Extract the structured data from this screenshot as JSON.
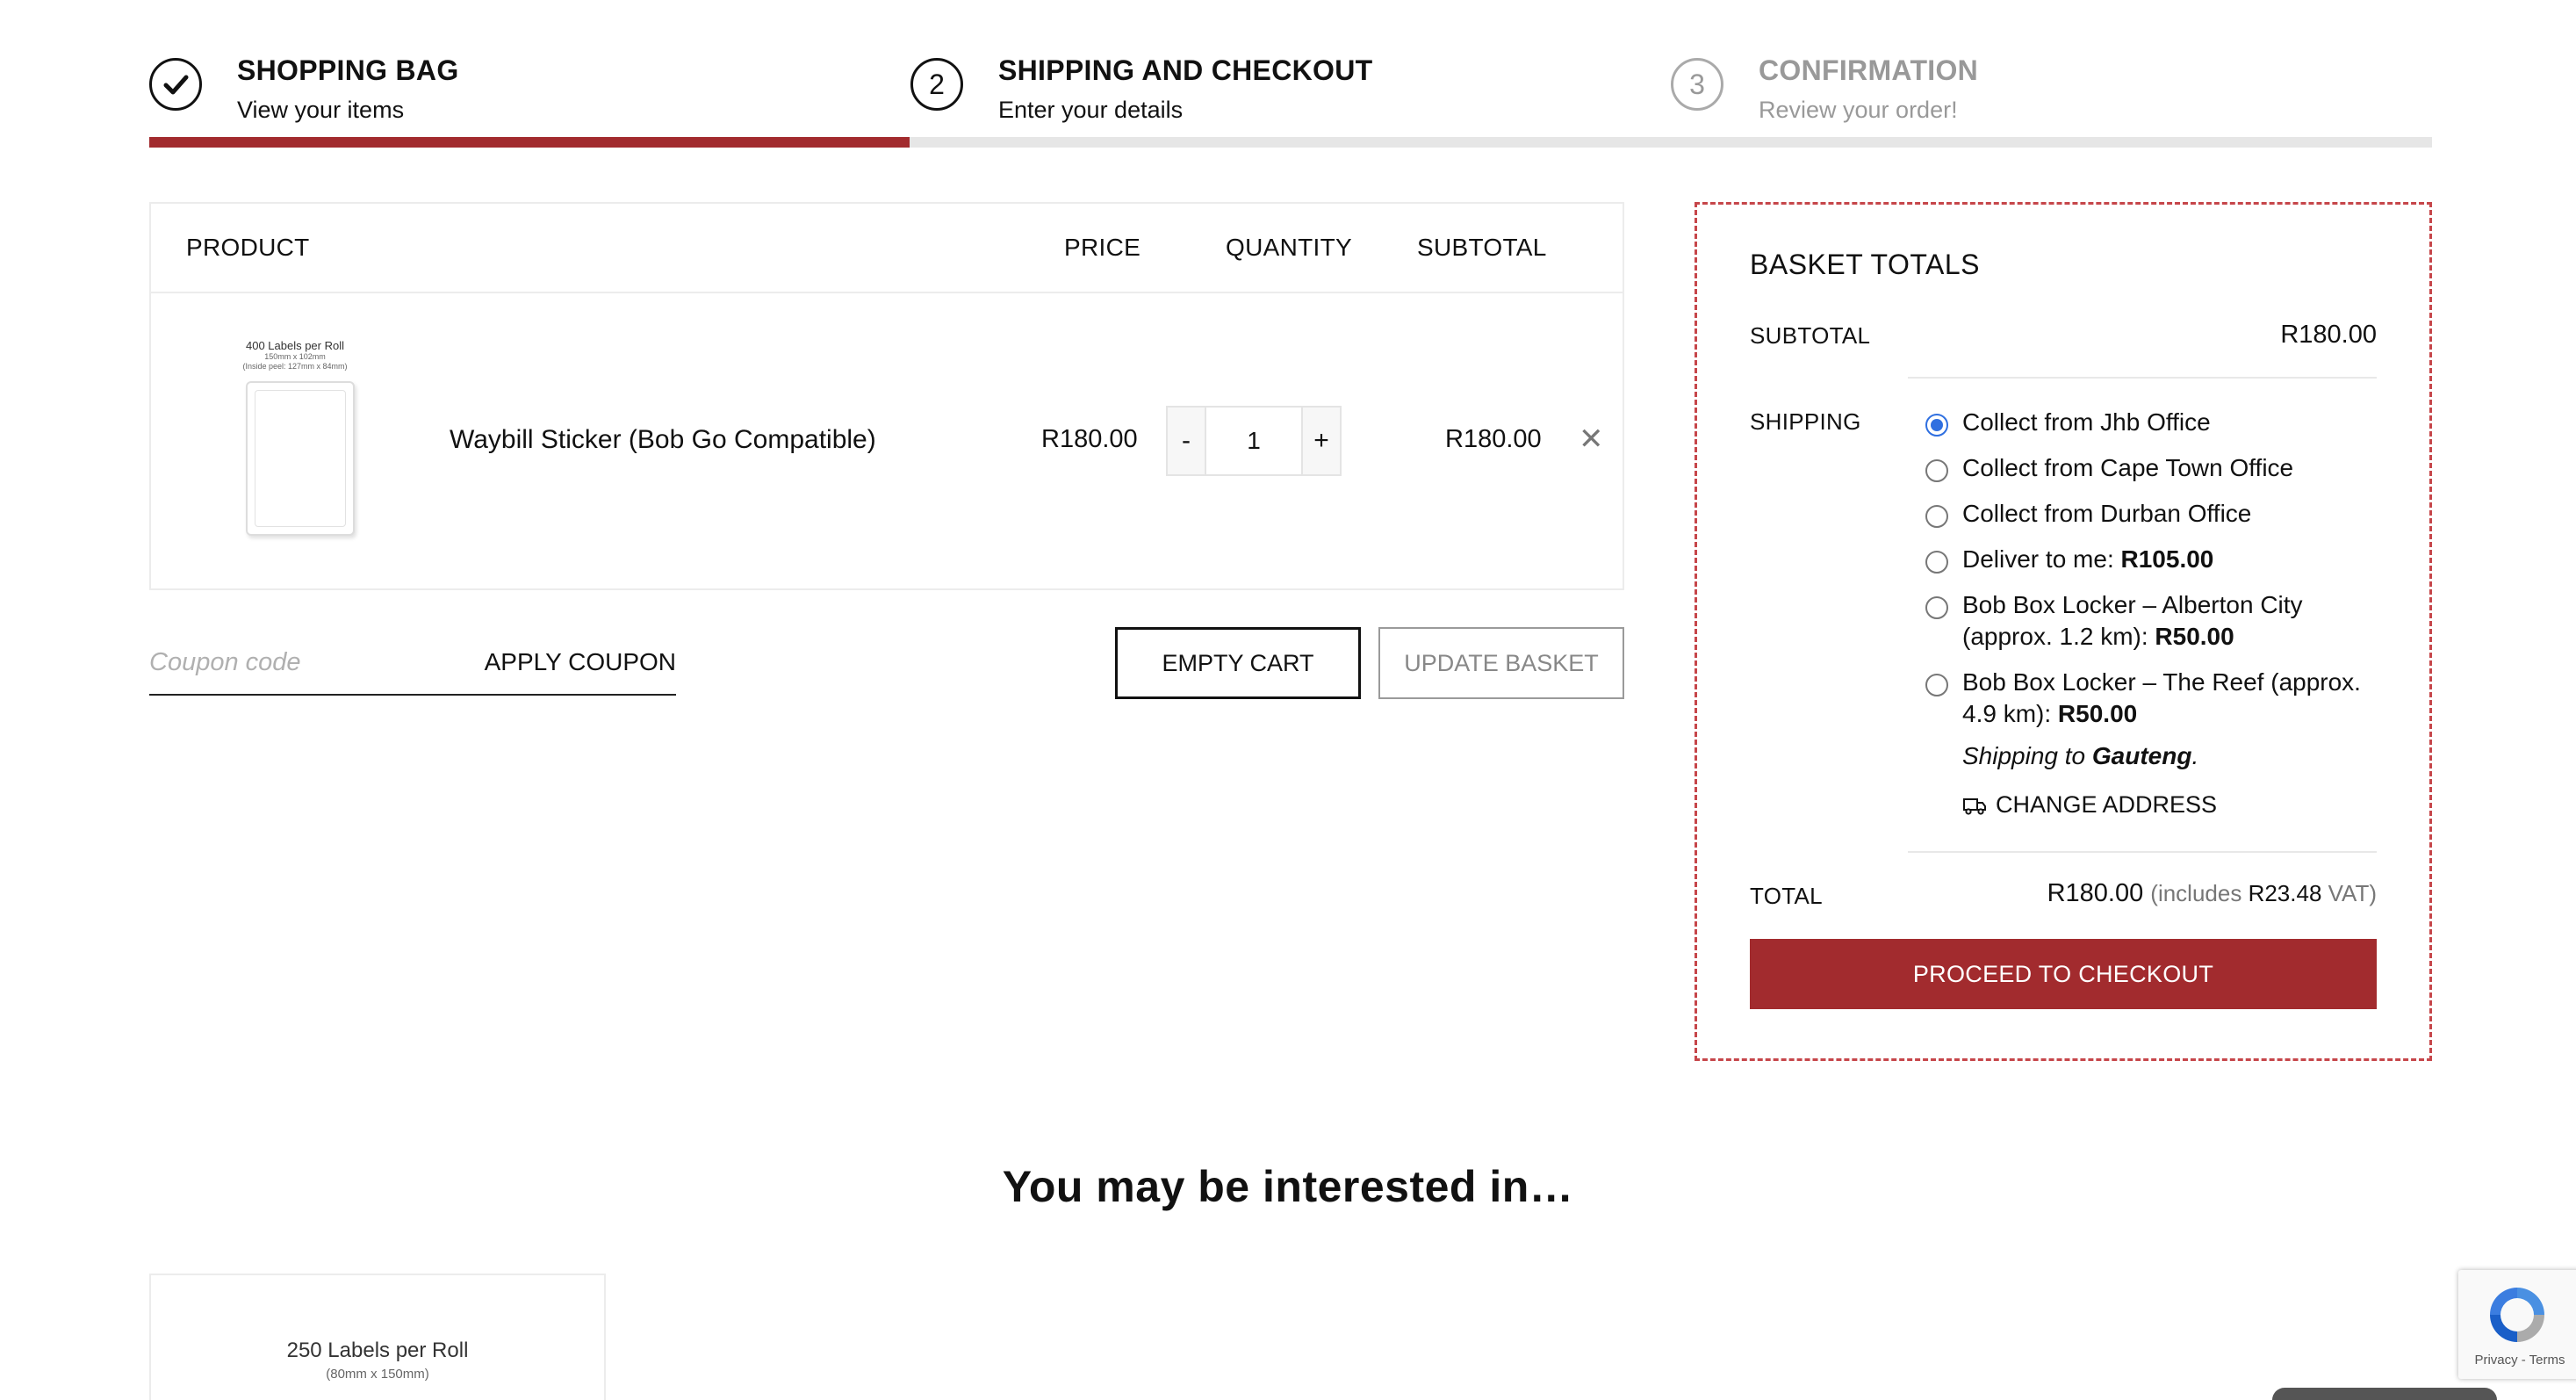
{
  "steps": [
    {
      "number": "1",
      "title": "SHOPPING BAG",
      "subtitle": "View your items",
      "state": "done"
    },
    {
      "number": "2",
      "title": "SHIPPING AND CHECKOUT",
      "subtitle": "Enter your details",
      "state": "current"
    },
    {
      "number": "3",
      "title": "CONFIRMATION",
      "subtitle": "Review your order!",
      "state": "upcoming"
    }
  ],
  "progress_fraction": 0.333,
  "cart": {
    "headers": {
      "product": "PRODUCT",
      "price": "PRICE",
      "quantity": "QUANTITY",
      "subtotal": "SUBTOTAL"
    },
    "items": [
      {
        "thumb_title": "400 Labels per Roll",
        "thumb_sub1": "150mm x 102mm",
        "thumb_sub2": "(Inside peel: 127mm x 84mm)",
        "name": "Waybill Sticker (Bob Go Compatible)",
        "price": "R180.00",
        "qty_minus": "-",
        "quantity": "1",
        "qty_plus": "+",
        "subtotal": "R180.00",
        "remove_icon": "close-x"
      }
    ]
  },
  "coupon": {
    "placeholder": "Coupon code",
    "apply_label": "APPLY COUPON"
  },
  "buttons": {
    "empty_cart": "EMPTY CART",
    "update_basket": "UPDATE BASKET"
  },
  "totals": {
    "title": "BASKET TOTALS",
    "subtotal_label": "SUBTOTAL",
    "subtotal_value": "R180.00",
    "shipping_label": "SHIPPING",
    "shipping_options": [
      {
        "text": "Collect from Jhb Office",
        "price": "",
        "checked": true
      },
      {
        "text": "Collect from Cape Town Office",
        "price": "",
        "checked": false
      },
      {
        "text": "Collect from Durban Office",
        "price": "",
        "checked": false
      },
      {
        "text": "Deliver to me: ",
        "price": "R105.00",
        "checked": false
      },
      {
        "text": "Bob Box Locker – Alberton City (approx. 1.2 km): ",
        "price": "R50.00",
        "checked": false
      },
      {
        "text": "Bob Box Locker – The Reef (approx. 4.9 km): ",
        "price": "R50.00",
        "checked": false
      }
    ],
    "shipping_to_prefix": "Shipping to ",
    "shipping_to_region": "Gauteng",
    "shipping_to_suffix": ".",
    "change_address": "CHANGE ADDRESS",
    "total_label": "TOTAL",
    "total_value": "R180.00",
    "vat_prefix": "(includes ",
    "vat_value": "R23.48",
    "vat_suffix": " VAT)",
    "checkout_button": "PROCEED TO CHECKOUT"
  },
  "interested_heading": "You may be interested in…",
  "recommendations": [
    {
      "title": "250 Labels per Roll",
      "sub": "(80mm x 150mm)"
    }
  ],
  "recaptcha": {
    "links": "Privacy - Terms"
  },
  "colors": {
    "accent": "#a22b2e",
    "radio": "#2f6fe0",
    "progress_track": "#e6e6e6"
  }
}
